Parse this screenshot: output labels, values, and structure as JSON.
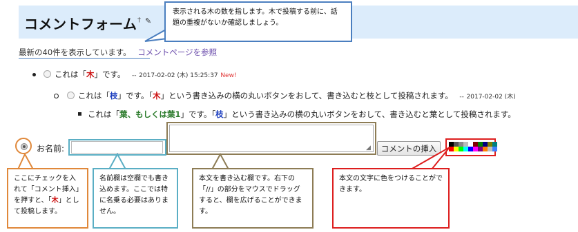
{
  "page": {
    "title": "コメントフォーム",
    "title_marker": "†",
    "edit_icon": "pencil-icon"
  },
  "summary": {
    "text": "最新の40件を表示しています。",
    "link": "コメントページを参照"
  },
  "comments": [
    {
      "level": 1,
      "parts": [
        "これは「",
        "木",
        "」です。"
      ],
      "date_sep": "--",
      "timestamp": "2017-02-02 (木) 15:25:37",
      "badge": "New!"
    },
    {
      "level": 2,
      "parts": [
        "これは「",
        "枝",
        "」です。「",
        "木",
        "」という書き込みの横の丸いボタンをおして、書き込むと枝として投稿されます。"
      ],
      "date_sep": "--",
      "timestamp": "2017-02-02 (木)"
    },
    {
      "level": 3,
      "parts": [
        "これは「",
        "葉、もしくは葉1",
        "」です。「",
        "枝",
        "」という書き込みの横の丸いボタンをおして、書き込むと葉として投稿されます。"
      ]
    }
  ],
  "form": {
    "name_label": "お名前:",
    "name_value": "",
    "body_value": "",
    "insert_button": "コメントの挿入",
    "resize_grip_icon": "resize-grip-icon",
    "palette": [
      "#000000",
      "#555555",
      "#888888",
      "#bbbbbb",
      "#ffffff",
      "#800000",
      "#008000",
      "#000080",
      "#808000",
      "#008080",
      "#ff0000",
      "#ffff00",
      "#00ff00",
      "#00ffff",
      "#0000ff",
      "#ff00ff",
      "#800080",
      "#ff8000",
      "#c0c0c0",
      "#4080ff"
    ]
  },
  "callouts": {
    "top": "表示される木の数を指します。木で投稿する前に、話題の重複がないか確認しましょう。",
    "radio": {
      "before": "ここにチェックを入れて「コメント挿入」を押すと、「",
      "highlight": "木",
      "after": "」として投稿します。"
    },
    "name": "名前欄は空欄でも書き込めます。ここでは特に名乗る必要はありません。",
    "body": "本文を書き込む欄です。右下の「//」の部分をマウスでドラッグすると、欄を広げることができます。",
    "color": "本文の文字に色をつけることができます。"
  },
  "colors": {
    "title_bg": "#dcecfb",
    "callout_top": "#4a7ebf",
    "callout_radio": "#e0883a",
    "callout_name": "#5aaec4",
    "callout_body": "#8d7c55",
    "callout_color": "#dd1e1e",
    "tree_red": "#cc1111",
    "branch_blue": "#1d3fbf",
    "leaf_green": "#2a7a2a"
  }
}
